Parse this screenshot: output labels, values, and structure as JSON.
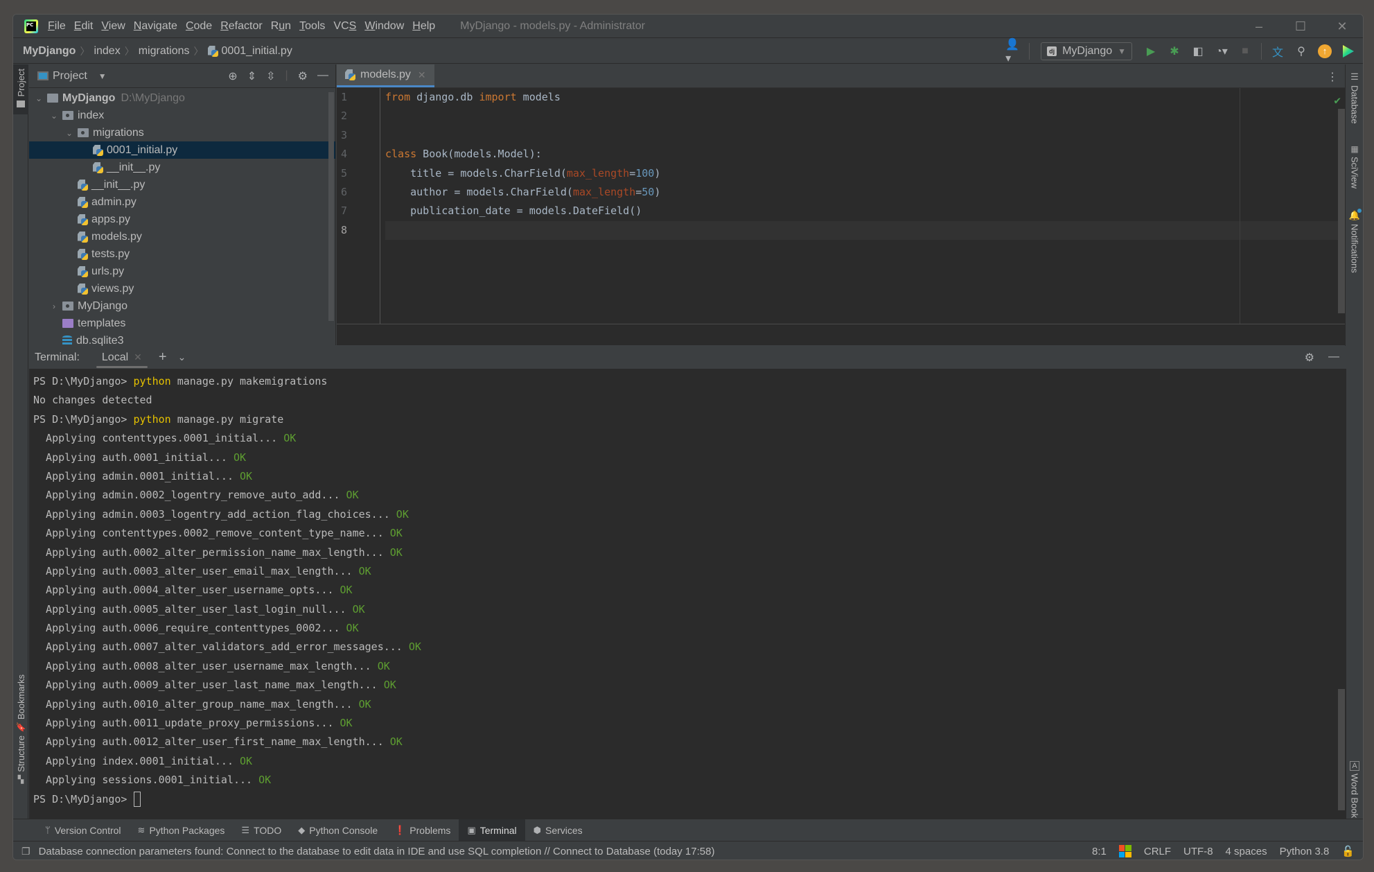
{
  "window": {
    "title": "MyDjango - models.py - Administrator",
    "menu": [
      {
        "mn": "F",
        "rest": "ile"
      },
      {
        "mn": "E",
        "rest": "dit"
      },
      {
        "mn": "V",
        "rest": "iew"
      },
      {
        "mn": "N",
        "rest": "avigate"
      },
      {
        "mn": "C",
        "rest": "ode"
      },
      {
        "mn": "R",
        "rest": "efactor"
      },
      {
        "pre": "R",
        "mn": "u",
        "rest": "n"
      },
      {
        "mn": "T",
        "rest": "ools"
      },
      {
        "pre": "VC",
        "mn": "S",
        "rest": ""
      },
      {
        "mn": "W",
        "rest": "indow"
      },
      {
        "mn": "H",
        "rest": "elp"
      }
    ],
    "controls": {
      "minimize": "–",
      "maximize": "☐",
      "close": "✕"
    }
  },
  "navbar": {
    "breadcrumbs": [
      "MyDjango",
      "index",
      "migrations",
      "0001_initial.py"
    ],
    "run_config": "MyDjango",
    "run_config_badge": "dj",
    "icons": [
      "user-icon",
      "run-icon",
      "debug-icon",
      "coverage-icon",
      "profile-icon",
      "stop-icon",
      "translate-icon",
      "search-icon",
      "update-icon",
      "plugin-logo-icon"
    ]
  },
  "project_panel": {
    "title": "Project",
    "tree": [
      {
        "label": "MyDjango",
        "path": "D:\\MyDjango",
        "type": "root",
        "depth": 0,
        "expanded": true
      },
      {
        "label": "index",
        "type": "module",
        "depth": 1,
        "expanded": true
      },
      {
        "label": "migrations",
        "type": "module",
        "depth": 2,
        "expanded": true
      },
      {
        "label": "0001_initial.py",
        "type": "python",
        "depth": 3,
        "selected": true
      },
      {
        "label": "__init__.py",
        "type": "python",
        "depth": 3
      },
      {
        "label": "__init__.py",
        "type": "python",
        "depth": 2
      },
      {
        "label": "admin.py",
        "type": "python",
        "depth": 2
      },
      {
        "label": "apps.py",
        "type": "python",
        "depth": 2
      },
      {
        "label": "models.py",
        "type": "python",
        "depth": 2
      },
      {
        "label": "tests.py",
        "type": "python",
        "depth": 2
      },
      {
        "label": "urls.py",
        "type": "python",
        "depth": 2
      },
      {
        "label": "views.py",
        "type": "python",
        "depth": 2
      },
      {
        "label": "MyDjango",
        "type": "module",
        "depth": 1,
        "expanded": false
      },
      {
        "label": "templates",
        "type": "templates",
        "depth": 1
      },
      {
        "label": "db.sqlite3",
        "type": "database",
        "depth": 1
      }
    ]
  },
  "editor": {
    "tab": "models.py",
    "current_line": 8,
    "lines": [
      [
        {
          "t": "from",
          "c": "kw"
        },
        {
          "t": " django.db "
        },
        {
          "t": "import",
          "c": "kw"
        },
        {
          "t": " models"
        }
      ],
      [],
      [],
      [
        {
          "t": "class",
          "c": "kw"
        },
        {
          "t": " Book(models.Model):"
        }
      ],
      [
        {
          "t": "    title = models.CharField("
        },
        {
          "t": "max_length",
          "c": "param"
        },
        {
          "t": "="
        },
        {
          "t": "100",
          "c": "num"
        },
        {
          "t": ")"
        }
      ],
      [
        {
          "t": "    author = models.CharField("
        },
        {
          "t": "max_length",
          "c": "param"
        },
        {
          "t": "="
        },
        {
          "t": "50",
          "c": "num"
        },
        {
          "t": ")"
        }
      ],
      [
        {
          "t": "    publication_date = models.DateField()"
        }
      ],
      []
    ]
  },
  "terminal": {
    "label": "Terminal:",
    "tab": "Local",
    "prompt": "PS D:\\MyDjango> ",
    "lines": [
      {
        "prompt": "PS D:\\MyDjango> ",
        "cmd": "python",
        "rest": " manage.py makemigrations"
      },
      {
        "text": "No changes detected"
      },
      {
        "prompt": "PS D:\\MyDjango> ",
        "cmd": "python",
        "rest": " manage.py migrate"
      },
      {
        "text": "  Applying contenttypes.0001_initial...",
        "status": "OK"
      },
      {
        "text": "  Applying auth.0001_initial...",
        "status": "OK"
      },
      {
        "text": "  Applying admin.0001_initial...",
        "status": "OK"
      },
      {
        "text": "  Applying admin.0002_logentry_remove_auto_add...",
        "status": "OK"
      },
      {
        "text": "  Applying admin.0003_logentry_add_action_flag_choices...",
        "status": "OK"
      },
      {
        "text": "  Applying contenttypes.0002_remove_content_type_name...",
        "status": "OK"
      },
      {
        "text": "  Applying auth.0002_alter_permission_name_max_length...",
        "status": "OK"
      },
      {
        "text": "  Applying auth.0003_alter_user_email_max_length...",
        "status": "OK"
      },
      {
        "text": "  Applying auth.0004_alter_user_username_opts...",
        "status": "OK"
      },
      {
        "text": "  Applying auth.0005_alter_user_last_login_null...",
        "status": "OK"
      },
      {
        "text": "  Applying auth.0006_require_contenttypes_0002...",
        "status": "OK"
      },
      {
        "text": "  Applying auth.0007_alter_validators_add_error_messages...",
        "status": "OK"
      },
      {
        "text": "  Applying auth.0008_alter_user_username_max_length...",
        "status": "OK"
      },
      {
        "text": "  Applying auth.0009_alter_user_last_name_max_length...",
        "status": "OK"
      },
      {
        "text": "  Applying auth.0010_alter_group_name_max_length...",
        "status": "OK"
      },
      {
        "text": "  Applying auth.0011_update_proxy_permissions...",
        "status": "OK"
      },
      {
        "text": "  Applying auth.0012_alter_user_first_name_max_length...",
        "status": "OK"
      },
      {
        "text": "  Applying index.0001_initial...",
        "status": "OK"
      },
      {
        "text": "  Applying sessions.0001_initial...",
        "status": "OK"
      },
      {
        "prompt": "PS D:\\MyDjango> ",
        "cursor": true
      }
    ]
  },
  "left_stripe": {
    "project": "Project",
    "bookmarks": "Bookmarks",
    "structure": "Structure"
  },
  "right_stripe": {
    "database": "Database",
    "sciview": "SciView",
    "notifications": "Notifications",
    "wordbook": "Word Book"
  },
  "tool_tabs": [
    {
      "label": "Version Control",
      "icon": "branch-icon",
      "glyph": "ᛘ"
    },
    {
      "label": "Python Packages",
      "icon": "layers-icon",
      "glyph": "≋"
    },
    {
      "label": "TODO",
      "icon": "list-icon",
      "glyph": "☰"
    },
    {
      "label": "Python Console",
      "icon": "python-icon",
      "glyph": "◆"
    },
    {
      "label": "Problems",
      "icon": "warning-icon",
      "glyph": "❗"
    },
    {
      "label": "Terminal",
      "icon": "terminal-icon",
      "glyph": "▣",
      "active": true
    },
    {
      "label": "Services",
      "icon": "services-icon",
      "glyph": "⬢"
    }
  ],
  "status": {
    "message": "Database connection parameters found: Connect to the database to edit data in IDE and use SQL completion // Connect to Database (today 17:58)",
    "position": "8:1",
    "line_ending": "CRLF",
    "encoding": "UTF-8",
    "indent": "4 spaces",
    "interpreter": "Python 3.8"
  },
  "colors": {
    "keyword": "#cc7832",
    "param": "#aa4926",
    "number": "#6897bb",
    "ok": "#5e9e31",
    "python_cmd": "#e5c100",
    "selection": "#0d293e"
  }
}
